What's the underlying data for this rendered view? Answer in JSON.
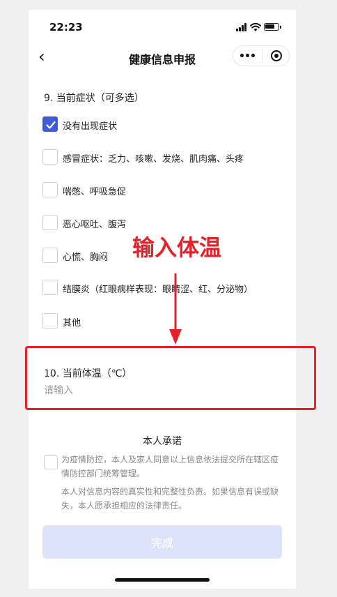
{
  "status_bar": {
    "time": "22:23"
  },
  "nav": {
    "back_glyph": "‹",
    "title": "健康信息申报",
    "more_icon": "more-dots-icon",
    "close_icon": "target-icon"
  },
  "question9": {
    "title": "9. 当前症状（可多选）",
    "options": [
      {
        "label": "没有出现症状",
        "checked": true
      },
      {
        "label": "感冒症状：乏力、咳嗽、发烧、肌肉痛、头疼",
        "checked": false
      },
      {
        "label": "喘憋、呼吸急促",
        "checked": false
      },
      {
        "label": "恶心呕吐、腹泻",
        "checked": false
      },
      {
        "label": "心慌、胸闷",
        "checked": false
      },
      {
        "label": "结膜炎（红眼病样表现：眼睛涩、红、分泌物）",
        "checked": false
      },
      {
        "label": "其他",
        "checked": false
      }
    ]
  },
  "annotation": {
    "text": "输入体温",
    "color": "#e8202a"
  },
  "question10": {
    "title": "10. 当前体温（℃）",
    "value": "",
    "placeholder": "请输入"
  },
  "promise": {
    "title": "本人承诺",
    "agree_checked": false,
    "text1": "为疫情防控，本人及家人同意以上信息依法提交所在辖区疫情防控部门统筹管理。",
    "text2": "本人对信息内容的真实性和完整性负责。如果信息有误或缺失，本人愿承担相应的法律责任。"
  },
  "submit": {
    "label": "完成",
    "disabled": true
  },
  "colors": {
    "accent": "#3f5bd8",
    "annotation_red": "#e8202a",
    "button_disabled_bg": "#dfe3f9"
  }
}
